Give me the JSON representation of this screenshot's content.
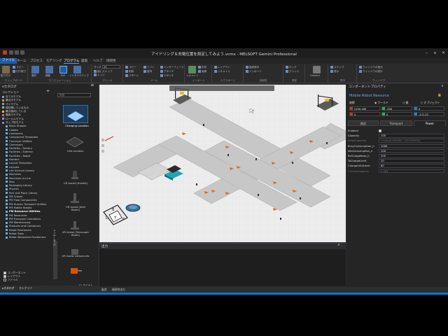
{
  "window": {
    "title": "アイドリング＆充電位置を設定してみよう.vcmx - MELSOFT Gemini Professional",
    "controls": [
      "minimize",
      "maximize",
      "close"
    ]
  },
  "ribbon_tabs": [
    "ファイル",
    "ホーム",
    "プロセス",
    "モデリング",
    "プログラム",
    "図面",
    "ヘルプ",
    "接続性"
  ],
  "ribbon": {
    "groups": [
      "クリップボード",
      "マニピュレーション",
      "グリッド",
      "ツール",
      "インポート",
      "エクスポート",
      "接続性",
      "測定",
      "表示",
      "ウィンドウ"
    ],
    "clipboard": [
      "貼り付け",
      "コピー",
      "切り取り"
    ],
    "manipulation": [
      "選択",
      "移動",
      "PnP",
      "インタラクティブ"
    ],
    "grid_size_label": "サイズ",
    "grid_size_value": "20",
    "grid_snaps": [
      "面にスナップ",
      "エッジ",
      "頂点"
    ],
    "tools": [
      "コピー",
      "削除",
      "パターン",
      "リフト",
      "整列",
      "インターフェース",
      "アタッチ",
      "デタッチ"
    ],
    "import": [
      "ジオメトリ",
      "形状",
      "画像"
    ],
    "export": [
      "レイアウト",
      "ジオメトリ"
    ],
    "connectivity": [
      "接続済み",
      "インポート"
    ],
    "measure": [
      "ロック",
      "グリッド"
    ],
    "camera": "Camera",
    "show": [
      "ステップ",
      "表示",
      "ヘルプ"
    ],
    "window": [
      "ウィンドウの復元",
      "ウィンドウの表示"
    ]
  },
  "left_panel": {
    "title": "eカタログ",
    "collections_label": "コレクション",
    "search_placeholder": "検索",
    "collections": [
      {
        "label": "全てのモデル",
        "color": "#6fa8dc"
      },
      {
        "label": "最近のモデル",
        "color": "#e69138"
      },
      {
        "label": "マイモデル",
        "color": "#6fa8dc"
      },
      {
        "label": "現在開いているもの",
        "color": "#93c47d"
      },
      {
        "label": "最近使用している",
        "color": "#f6b26b"
      },
      {
        "label": "最新のモデル",
        "color": "#e06666"
      },
      {
        "label": "ローカルモデル",
        "color": "#6fa8dc"
      },
      {
        "label": "タイプ別モデル",
        "color": "#8e7cc3"
      },
      {
        "label": "Basic Shapes",
        "color": "#6fa8dc"
      },
      {
        "label": "Cobots",
        "color": "#6fa8dc"
      },
      {
        "label": "Containers",
        "color": "#6fa8dc"
      },
      {
        "label": "Component Templates",
        "color": "#6fa8dc"
      },
      {
        "label": "Conveyor Utilities",
        "color": "#6fa8dc"
      },
      {
        "label": "Conveyors",
        "color": "#6fa8dc"
      },
      {
        "label": "Facilities - Factory",
        "color": "#6fa8dc"
      },
      {
        "label": "Facilities - Exterior",
        "color": "#6fa8dc"
      },
      {
        "label": "Facilities - Robot",
        "color": "#6fa8dc"
      },
      {
        "label": "Feeders",
        "color": "#6fa8dc"
      },
      {
        "label": "Layout Templates",
        "color": "#6fa8dc"
      },
      {
        "label": "Layouts",
        "color": "#6fa8dc"
      },
      {
        "label": "Life Science Library",
        "color": "#6fa8dc"
      },
      {
        "label": "Machines",
        "color": "#6fa8dc"
      },
      {
        "label": "Machines In-Line",
        "color": "#6fa8dc"
      },
      {
        "label": "Misc",
        "color": "#6fa8dc"
      },
      {
        "label": "Packaging Library",
        "color": "#6fa8dc"
      },
      {
        "label": "Physics",
        "color": "#6fa8dc"
      },
      {
        "label": "Pick and Place Library",
        "color": "#6fa8dc"
      },
      {
        "label": "PM Cranes",
        "color": "#6fa8dc"
      },
      {
        "label": "PM Flow Components",
        "color": "#6fa8dc"
      },
      {
        "label": "PM Human Transport Utilities",
        "color": "#6fa8dc"
      },
      {
        "label": "PM Mobile Robots",
        "color": "#6fa8dc"
      },
      {
        "label": "PM Resource Utilities",
        "color": "#6fa8dc",
        "bold": true
      },
      {
        "label": "PM Resources",
        "color": "#6fa8dc"
      },
      {
        "label": "PM Transport Controllers",
        "color": "#6fa8dc"
      },
      {
        "label": "PM Warehousing",
        "color": "#6fa8dc"
      },
      {
        "label": "Products and Containers",
        "color": "#6fa8dc"
      },
      {
        "label": "Robot Positioners",
        "color": "#6fa8dc"
      },
      {
        "label": "Robot Tools",
        "color": "#6fa8dc"
      },
      {
        "label": "Robot Workpiece Positioners",
        "color": "#6fa8dc"
      }
    ],
    "gallery": [
      {
        "label": "Charging Location"
      },
      {
        "label": "Idle Location"
      },
      {
        "label": "UR Assist (Handle)"
      },
      {
        "label": "UR Assist (Jolet Boom)"
      },
      {
        "label": "UR Assist (Telescopic Boom)"
      },
      {
        "label": "UR Assist cartsecorts"
      }
    ],
    "vertical_tab": "コンポーネント",
    "checks": [
      {
        "label": "コンポーネント",
        "checked": true
      },
      {
        "label": "レイアウト",
        "checked": true
      },
      {
        "label": "ファイル",
        "checked": false
      }
    ],
    "item_count": "10 アイテム",
    "bottom_tabs": [
      "eカタログ",
      "セルグラフ"
    ]
  },
  "viewport": {
    "nav_cube_faces": [
      "B",
      "L",
      "T",
      "F"
    ]
  },
  "output": {
    "title": "出力",
    "tabs": [
      "出力",
      "接続性出力"
    ]
  },
  "right_panel": {
    "title": "コンポーネントプロパティ",
    "component_name": "Mobile Robot Resource",
    "coord_frame_label": "座標",
    "coord_options": [
      "ワールド",
      "親",
      "オブジェクト"
    ],
    "coord_selected": "ワールド",
    "coords": {
      "x": "2150.185",
      "y": "-500",
      "z": "0",
      "rx": "0",
      "ry": "0",
      "rz": "-171.22"
    },
    "sub_tabs": [
      "既定",
      "Transport",
      "Power"
    ],
    "active_sub_tab": "Power",
    "properties": [
      {
        "name": "Enabled",
        "value": "",
        "checkbox": true
      },
      {
        "name": "Capacity",
        "value": "100"
      },
      {
        "name": "InitialCapacity",
        "value": "Linear(0.000000, 100.000000)",
        "dim": true
      },
      {
        "name": "BusyConsumption_h",
        "value": "1000"
      },
      {
        "name": "IdleConsumption_h",
        "value": "100"
      },
      {
        "name": "ReChargeRate_h",
        "value": "200"
      },
      {
        "name": "ToChargeLimit",
        "value": "20"
      },
      {
        "name": "ChargeUntilLevel",
        "value": "80"
      },
      {
        "name": "CurrentCapacity",
        "value": "9.364",
        "dim": true
      }
    ]
  },
  "colors": {
    "accent": "#007acc",
    "background": "#2d2d30",
    "panel": "#252526",
    "floor": "#e9e9e9",
    "path": "#c9c9c9",
    "arrow": "#e8631a"
  }
}
